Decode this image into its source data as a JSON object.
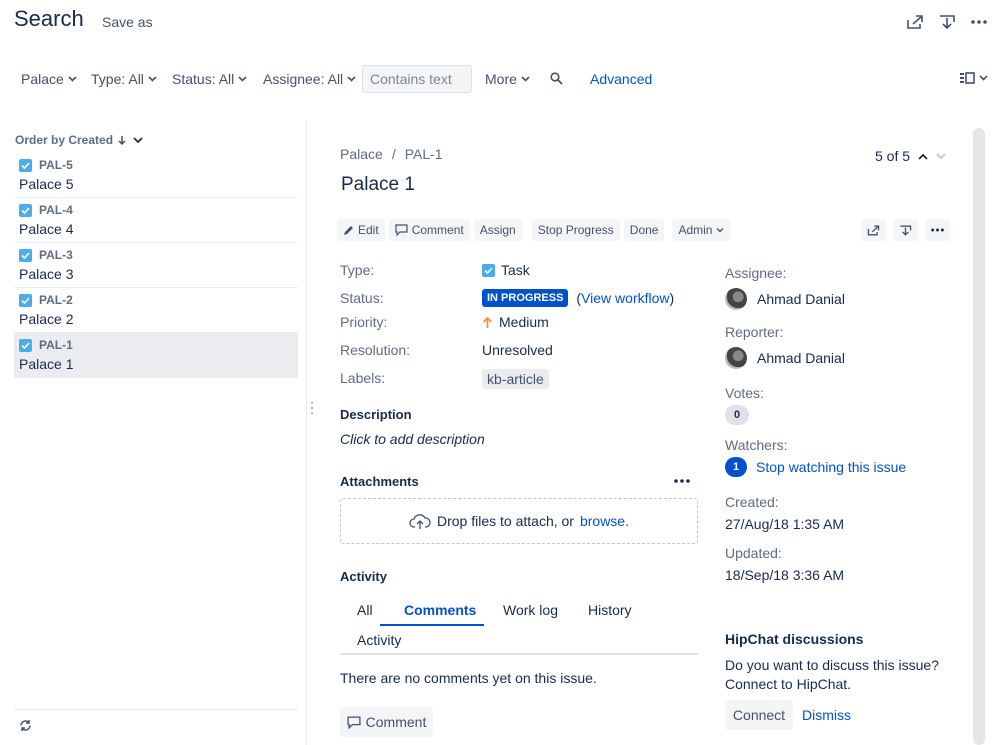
{
  "header": {
    "title": "Search",
    "save_as": "Save as"
  },
  "filters": {
    "project": "Palace",
    "type": "Type: All",
    "status": "Status: All",
    "assignee": "Assignee: All",
    "search_placeholder": "Contains text",
    "more": "More",
    "advanced": "Advanced"
  },
  "list": {
    "order_by": "Order by Created",
    "items": [
      {
        "key": "PAL-5",
        "summary": "Palace 5"
      },
      {
        "key": "PAL-4",
        "summary": "Palace 4"
      },
      {
        "key": "PAL-3",
        "summary": "Palace 3"
      },
      {
        "key": "PAL-2",
        "summary": "Palace 2"
      },
      {
        "key": "PAL-1",
        "summary": "Palace 1"
      }
    ]
  },
  "issue": {
    "breadcrumb_project": "Palace",
    "breadcrumb_sep": "/",
    "breadcrumb_key": "PAL-1",
    "title": "Palace 1",
    "pager": "5 of 5",
    "toolbar": {
      "edit": "Edit",
      "comment": "Comment",
      "assign": "Assign",
      "stop_progress": "Stop Progress",
      "done": "Done",
      "admin": "Admin"
    },
    "fields": {
      "type_label": "Type:",
      "type_value": "Task",
      "status_label": "Status:",
      "status_value": "IN PROGRESS",
      "view_workflow": "View workflow",
      "priority_label": "Priority:",
      "priority_value": "Medium",
      "resolution_label": "Resolution:",
      "resolution_value": "Unresolved",
      "labels_label": "Labels:",
      "labels_value": "kb-article"
    },
    "description_head": "Description",
    "description_placeholder": "Click to add description",
    "attachments_head": "Attachments",
    "drop_text": "Drop files to attach, or",
    "browse": "browse.",
    "activity_head": "Activity",
    "tabs": {
      "all": "All",
      "comments": "Comments",
      "work_log": "Work log",
      "history": "History",
      "activity": "Activity"
    },
    "no_comments": "There are no comments yet on this issue.",
    "comment_button": "Comment"
  },
  "people": {
    "assignee_label": "Assignee:",
    "assignee": "Ahmad Danial",
    "reporter_label": "Reporter:",
    "reporter": "Ahmad Danial",
    "votes_label": "Votes:",
    "votes": "0",
    "watchers_label": "Watchers:",
    "watchers": "1",
    "stop_watching": "Stop watching this issue"
  },
  "dates": {
    "created_label": "Created:",
    "created": "27/Aug/18 1:35 AM",
    "updated_label": "Updated:",
    "updated": "18/Sep/18 3:36 AM"
  },
  "hipchat": {
    "title": "HipChat discussions",
    "text": "Do you want to discuss this issue? Connect to HipChat.",
    "connect": "Connect",
    "dismiss": "Dismiss"
  },
  "colors": {
    "accent": "#0052cc",
    "status": "#0052cc",
    "task_icon": "#4bade8",
    "priority_medium": "#f79232"
  }
}
